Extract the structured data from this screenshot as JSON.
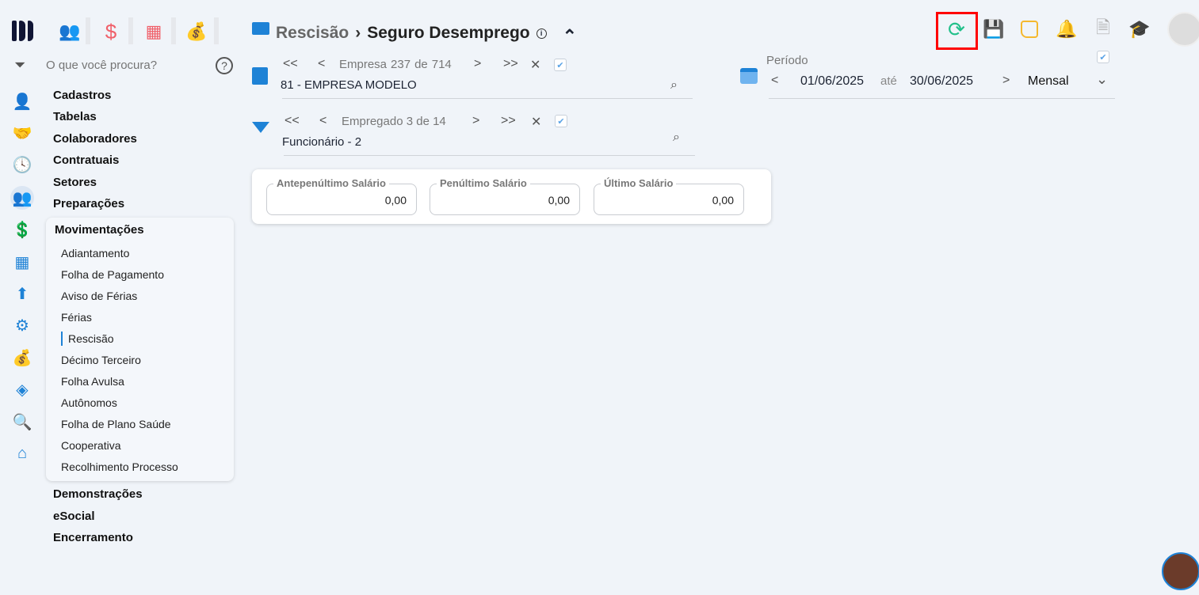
{
  "header": {
    "breadcrumb_parent": "Rescisão",
    "breadcrumb_sep": "›",
    "title": "Seguro Desemprego",
    "info": "i",
    "collapse": "⌃"
  },
  "search": {
    "placeholder": "O que você procura?",
    "help": "?"
  },
  "menu": {
    "items": [
      "Cadastros",
      "Tabelas",
      "Colaboradores",
      "Contratuais",
      "Setores",
      "Preparações"
    ],
    "open_group": "Movimentações",
    "sub_items": [
      "Adiantamento",
      "Folha de Pagamento",
      "Aviso de Férias",
      "Férias",
      "Rescisão",
      "Décimo Terceiro",
      "Folha Avulsa",
      "Autônomos",
      "Folha de Plano Saúde",
      "Cooperativa",
      "Recolhimento Processo"
    ],
    "after": [
      "Demonstrações",
      "eSocial",
      "Encerramento"
    ]
  },
  "empresa": {
    "first": "<<",
    "prev": "<",
    "label": "Empresa",
    "current": "237",
    "of": "de",
    "total": "714",
    "next": ">",
    "last": ">>",
    "clear": "✕",
    "value": "81 - EMPRESA MODELO"
  },
  "empregado": {
    "first": "<<",
    "prev": "<",
    "text": "Empregado 3 de 14",
    "next": ">",
    "last": ">>",
    "clear": "✕",
    "value": "Funcionário - 2"
  },
  "periodo": {
    "label": "Período",
    "start": "01/06/2025",
    "until": "até",
    "end": "30/06/2025",
    "type": "Mensal"
  },
  "salarios": [
    {
      "label": "Antepenúltimo Salário",
      "value": "0,00"
    },
    {
      "label": "Penúltimo Salário",
      "value": "0,00"
    },
    {
      "label": "Último Salário",
      "value": "0,00"
    }
  ],
  "colors": {
    "accent": "#1e82d6",
    "red_icons": "#f0606a",
    "refresh": "#22c08a",
    "highlight": "#ff0000"
  }
}
